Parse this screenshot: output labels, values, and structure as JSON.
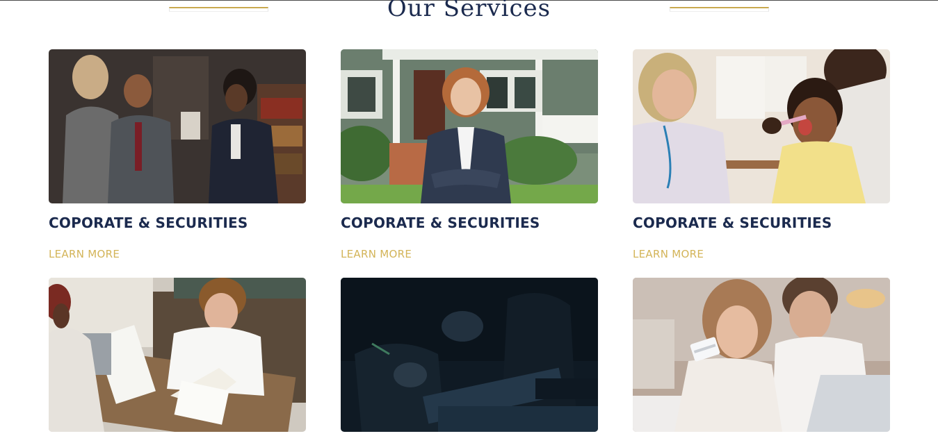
{
  "section": {
    "title": "Our Services"
  },
  "colors": {
    "navy": "#1b2a4e",
    "gold": "#d3b458"
  },
  "cards": [
    {
      "title": "COPORATE & SECURITIES",
      "link": "LEARN MORE",
      "image": "business-meeting-photo"
    },
    {
      "title": "COPORATE & SECURITIES",
      "link": "LEARN MORE",
      "image": "woman-in-front-of-house-photo"
    },
    {
      "title": "COPORATE & SECURITIES",
      "link": "LEARN MORE",
      "image": "dentist-with-child-photo"
    },
    {
      "image": "people-reviewing-documents-photo"
    },
    {
      "image": "signing-documents-dark-photo"
    },
    {
      "image": "couple-with-credit-card-photo"
    }
  ]
}
